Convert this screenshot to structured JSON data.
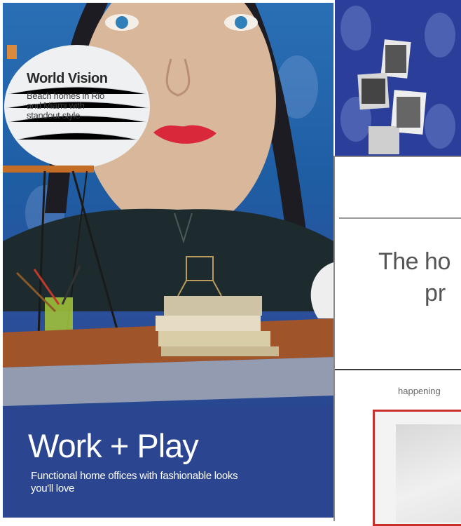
{
  "cover": {
    "feature_title": "World Vision",
    "feature_subtitle": "Beach homes in Rio and Miami with standout style",
    "headline": "Work + Play",
    "subline": "Functional home offices with fashionable looks you'll love"
  },
  "web_fragment": {
    "hero_line1": "The ho",
    "hero_line2": "pr",
    "section_label": "happening"
  },
  "colors": {
    "wallpaper_blue": "#2a5fae",
    "frame_red": "#c9302c"
  }
}
